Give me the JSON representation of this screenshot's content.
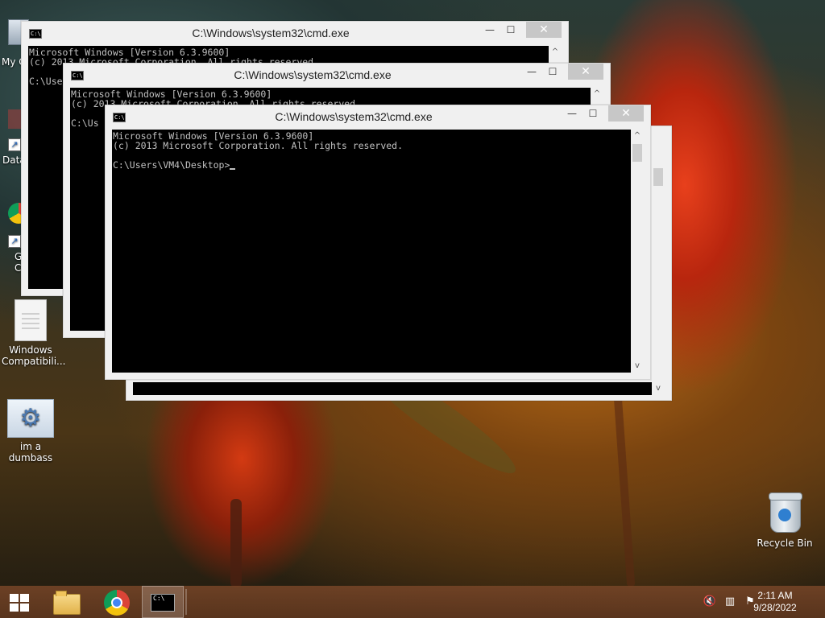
{
  "desktop": {
    "icons": [
      {
        "label": "Windows Compatibili..."
      },
      {
        "label": "im a dumbass"
      },
      {
        "label": "Recycle Bin"
      }
    ],
    "partial_labels": [
      "My C",
      "Data",
      "G",
      "C"
    ]
  },
  "windows": [
    {
      "title": "C:\\Windows\\system32\\cmd.exe",
      "lines": [
        "Microsoft Windows [Version 6.3.9600]",
        "(c) 2013 Microsoft Corporation. All rights reserved.",
        "",
        "C:\\Use"
      ]
    },
    {
      "title": "C:\\Windows\\system32\\cmd.exe",
      "lines": [
        "Microsoft Windows [Version 6.3.9600]",
        "(c) 2013 Microsoft Corporation. All rights reserved.",
        "",
        "C:\\Us"
      ]
    },
    {
      "title": "C:\\Windows\\system32\\cmd.exe",
      "lines": [
        "Microsoft Windows [Version 6.3.9600]",
        "(c) 2013 Microsoft Corporation. All rights reserved.",
        "",
        "C:\\Users\\VM4\\Desktop>"
      ]
    }
  ],
  "window_controls": {
    "minimize": "—",
    "maximize": "☐",
    "close": "✕"
  },
  "console_icon_text": "C:\\",
  "taskbar": {
    "clock_time": "2:11 AM",
    "clock_date": "9/28/2022",
    "tray_icons": [
      "speaker-muted-icon",
      "network-icon",
      "action-center-flag-icon"
    ]
  }
}
